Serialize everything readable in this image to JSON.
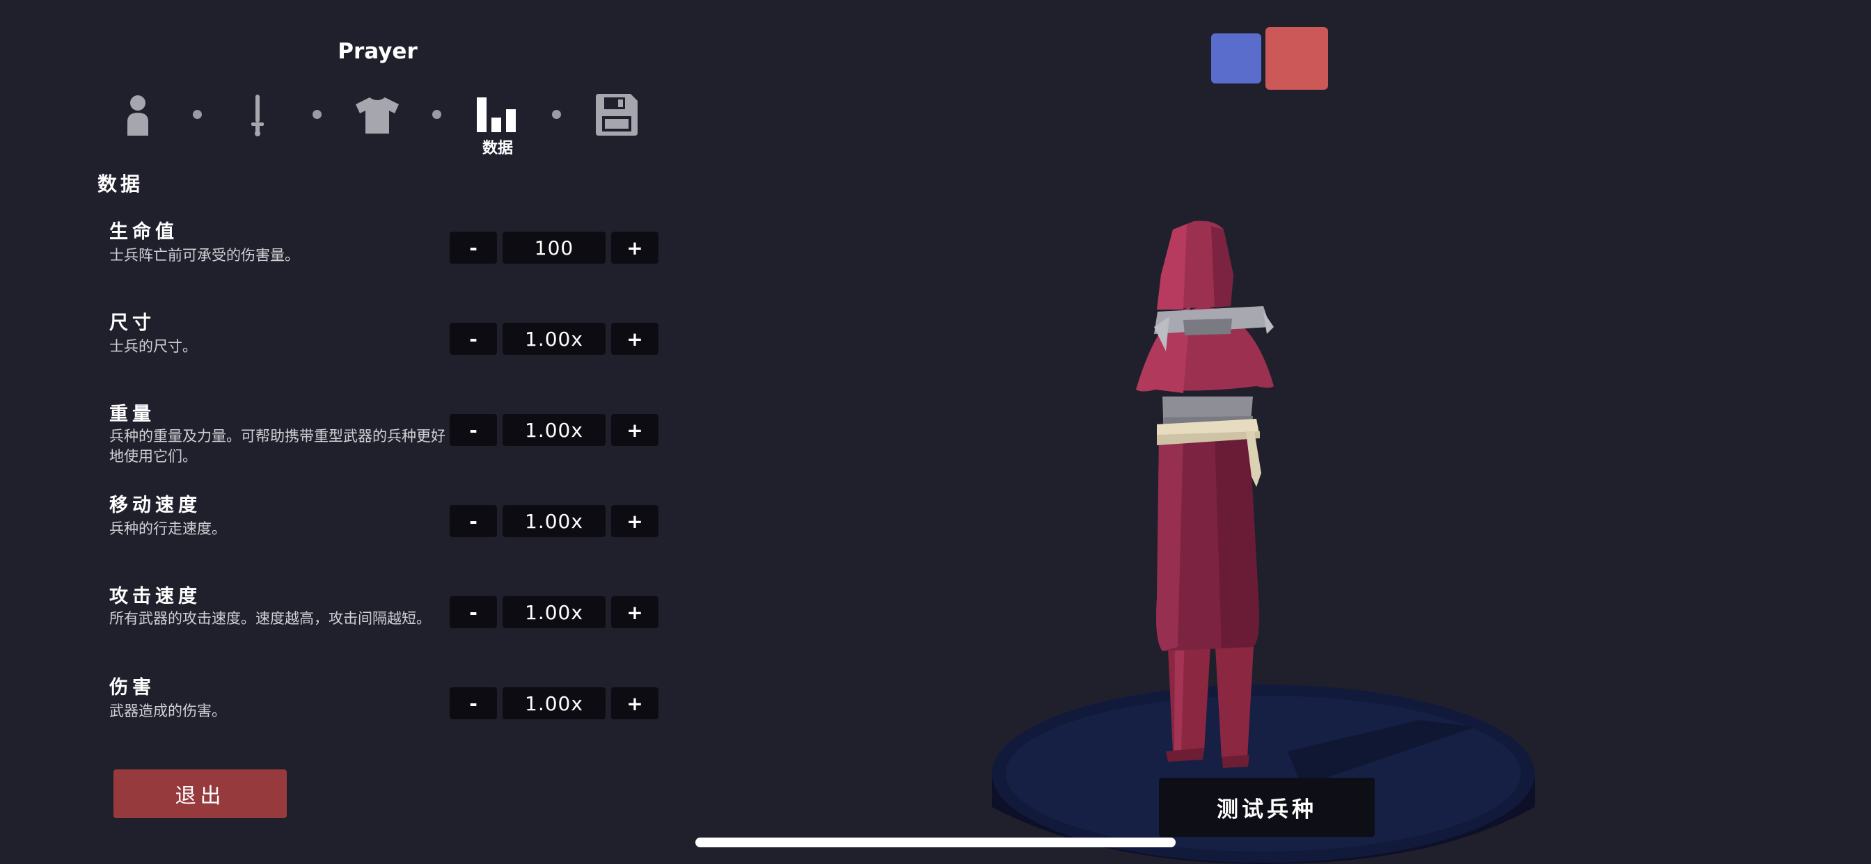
{
  "unit": {
    "name": "Prayer"
  },
  "nav": {
    "items": [
      {
        "icon": "person-icon"
      },
      {
        "icon": "sword-icon"
      },
      {
        "icon": "shirt-icon"
      },
      {
        "icon": "bar-chart-icon",
        "label": "数据",
        "active": true
      },
      {
        "icon": "save-icon"
      }
    ]
  },
  "section": {
    "title": "数据"
  },
  "stats": [
    {
      "title": "生命值",
      "desc": "士兵阵亡前可承受的伤害量。",
      "value": "100"
    },
    {
      "title": "尺寸",
      "desc": "士兵的尺寸。",
      "value": "1.00x"
    },
    {
      "title": "重量",
      "desc": "兵种的重量及力量。可帮助携带重型武器的兵种更好地使用它们。",
      "value": "1.00x"
    },
    {
      "title": "移动速度",
      "desc": "兵种的行走速度。",
      "value": "1.00x"
    },
    {
      "title": "攻击速度",
      "desc": "所有武器的攻击速度。速度越高，攻击间隔越短。",
      "value": "1.00x"
    },
    {
      "title": "伤害",
      "desc": "武器造成的伤害。",
      "value": "1.00x"
    }
  ],
  "stepper": {
    "minus": "-",
    "plus": "+"
  },
  "exit_label": "退出",
  "test_label": "测试兵种",
  "team_colors": {
    "blue": "#5b6dcc",
    "red": "#cc5858"
  }
}
